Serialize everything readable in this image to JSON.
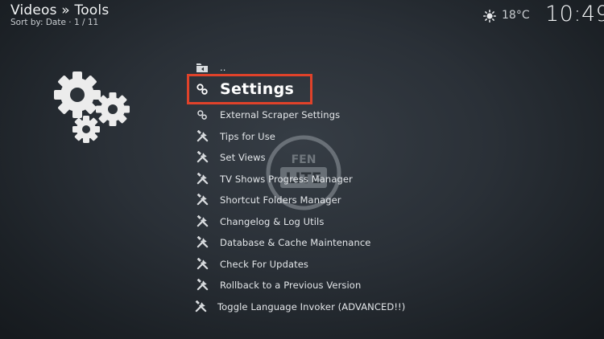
{
  "header": {
    "title": "Videos » Tools",
    "sort": "Sort by: Date  ·  1 / 11"
  },
  "status": {
    "weather_icon": "sun-icon",
    "temperature": "18°C",
    "time": "10:49"
  },
  "menu": {
    "focused_index": 1,
    "items": [
      {
        "label": "..",
        "icon": "folder-back-icon"
      },
      {
        "label": "Settings",
        "icon": "settings-icon"
      },
      {
        "label": "External Scraper Settings",
        "icon": "settings-icon"
      },
      {
        "label": "Tips for Use",
        "icon": "tools-icon"
      },
      {
        "label": "Set Views",
        "icon": "tools-icon"
      },
      {
        "label": "TV Shows Progress Manager",
        "icon": "tools-icon"
      },
      {
        "label": "Shortcut Folders Manager",
        "icon": "tools-icon"
      },
      {
        "label": "Changelog & Log Utils",
        "icon": "tools-icon"
      },
      {
        "label": "Database & Cache Maintenance",
        "icon": "tools-icon"
      },
      {
        "label": "Check For Updates",
        "icon": "tools-icon"
      },
      {
        "label": "Rollback to a Previous Version",
        "icon": "tools-icon"
      },
      {
        "label": "Toggle Language Invoker (ADVANCED!!)",
        "icon": "tools-icon"
      }
    ]
  },
  "watermark": {
    "line1": "FEN",
    "line2": "LITE"
  },
  "colors": {
    "focus_border": "#e0422a",
    "text": "#e4e7ea"
  }
}
